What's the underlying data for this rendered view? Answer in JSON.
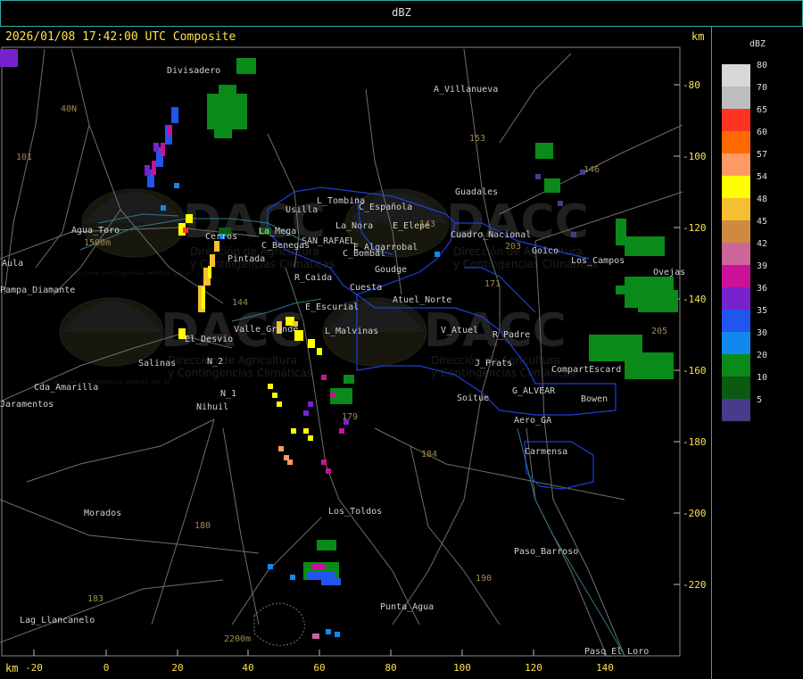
{
  "header": {
    "title": "dBZ"
  },
  "map": {
    "datetime": "2026/01/08 17:42:00 UTC Composite",
    "unit_top": "km",
    "unit_bottom": "km",
    "x_ticks": [
      "-20",
      "0",
      "20",
      "40",
      "60",
      "80",
      "100",
      "120",
      "140"
    ],
    "y_ticks": [
      "-80",
      "-100",
      "-120",
      "-140",
      "-160",
      "-180",
      "-200",
      "-220"
    ],
    "places": [
      {
        "name": "Divisadero"
      },
      {
        "name": "A_Villanueva"
      },
      {
        "name": "Agua_Toro"
      },
      {
        "name": "Aula"
      },
      {
        "name": "Pampa_Diamante"
      },
      {
        "name": "Usilla"
      },
      {
        "name": "L_Tombina"
      },
      {
        "name": "C_Española"
      },
      {
        "name": "La_Nora"
      },
      {
        "name": "E_Elepe"
      },
      {
        "name": "Guadales"
      },
      {
        "name": "Cuadro_Nacional"
      },
      {
        "name": "C_Benegas"
      },
      {
        "name": "SAN_RAFAEL"
      },
      {
        "name": "E_Algarrobal"
      },
      {
        "name": "C_Bombal"
      },
      {
        "name": "Pintada"
      },
      {
        "name": "R_Caida"
      },
      {
        "name": "Goudge"
      },
      {
        "name": "Cuesta"
      },
      {
        "name": "E_Escurial"
      },
      {
        "name": "Atuel_Norte"
      },
      {
        "name": "V_Atuel"
      },
      {
        "name": "R_Padre"
      },
      {
        "name": "Valle_Grande"
      },
      {
        "name": "L_Malvinas"
      },
      {
        "name": "El_Desvio"
      },
      {
        "name": "Salinas"
      },
      {
        "name": "N_2"
      },
      {
        "name": "Cda_Amarilla"
      },
      {
        "name": "N_1"
      },
      {
        "name": "Nihuil"
      },
      {
        "name": "Jaramentos"
      },
      {
        "name": "J_Prats"
      },
      {
        "name": "CompartEscard"
      },
      {
        "name": "Soitue"
      },
      {
        "name": "G_ALVEAR"
      },
      {
        "name": "Bowen"
      },
      {
        "name": "Aero_GA"
      },
      {
        "name": "Carmensa"
      },
      {
        "name": "Morados"
      },
      {
        "name": "Los_Toldos"
      },
      {
        "name": "Paso_Barroso"
      },
      {
        "name": "Punta_Agua"
      },
      {
        "name": "Lag_Llancanelo"
      },
      {
        "name": "Paso_El_Loro"
      },
      {
        "name": "Goico"
      },
      {
        "name": "Los_Campos"
      },
      {
        "name": "Ovejas"
      },
      {
        "name": "Cerros"
      },
      {
        "name": "La_Mega"
      },
      {
        "name": "1500m"
      },
      {
        "name": "2200m"
      },
      {
        "name": "40N"
      },
      {
        "name": "101"
      },
      {
        "name": "153"
      },
      {
        "name": "146"
      },
      {
        "name": "143"
      },
      {
        "name": "171"
      },
      {
        "name": "203"
      },
      {
        "name": "144"
      },
      {
        "name": "179"
      },
      {
        "name": "184"
      },
      {
        "name": "180"
      },
      {
        "name": "183"
      },
      {
        "name": "190"
      },
      {
        "name": "205"
      }
    ]
  },
  "watermark": {
    "brand": "DACC",
    "line1": "Dirección de Agricultura",
    "line2": "y Contingencias Climáticas",
    "url": "http://www.contingencias.mendoza.gov.ar"
  },
  "legend": {
    "title": "dBZ",
    "entries": [
      {
        "label": "80",
        "color": "#d8d8d8"
      },
      {
        "label": "70",
        "color": "#bdbdbd"
      },
      {
        "label": "65",
        "color": "#ff3322"
      },
      {
        "label": "60",
        "color": "#ff6a00"
      },
      {
        "label": "57",
        "color": "#ff9966"
      },
      {
        "label": "54",
        "color": "#ffff00"
      },
      {
        "label": "48",
        "color": "#f5c030"
      },
      {
        "label": "45",
        "color": "#d08a40"
      },
      {
        "label": "42",
        "color": "#cc6699"
      },
      {
        "label": "39",
        "color": "#cc1199"
      },
      {
        "label": "36",
        "color": "#7722cc"
      },
      {
        "label": "35",
        "color": "#2255ee"
      },
      {
        "label": "30",
        "color": "#1188ee"
      },
      {
        "label": "20",
        "color": "#0a8a18"
      },
      {
        "label": "10",
        "color": "#0a5a12"
      },
      {
        "label": "5",
        "color": "#4a3a8a"
      }
    ]
  }
}
